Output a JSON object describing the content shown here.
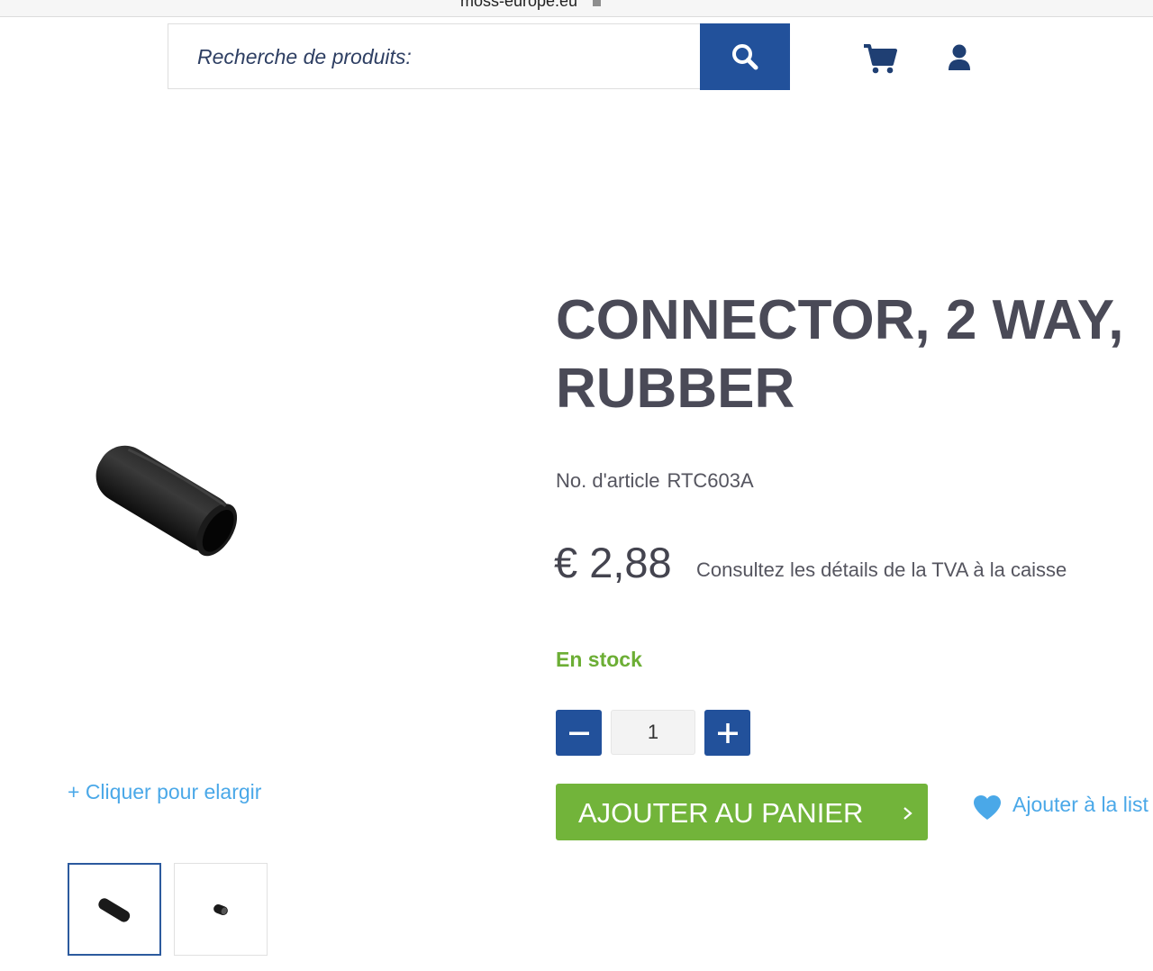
{
  "browser": {
    "url": "moss-europe.eu"
  },
  "header": {
    "search_placeholder": "Recherche de produits:",
    "icons": {
      "search": "search-icon",
      "cart": "cart-icon",
      "account": "user-icon"
    }
  },
  "gallery": {
    "enlarge_label": "+ Cliquer pour elargir",
    "thumbnails": [
      {
        "name": "thumbnail-1",
        "active": true
      },
      {
        "name": "thumbnail-2",
        "active": false
      }
    ]
  },
  "product": {
    "title_line1": "CONNECTOR, 2 WAY,",
    "title_line2": "RUBBER",
    "sku_label": "No. d'article",
    "sku_value": "RTC603A",
    "price": "€ 2,88",
    "vat_note": "Consultez les détails de la TVA à la caisse",
    "stock_status": "En stock",
    "quantity": "1",
    "add_to_cart_label": "AJOUTER AU PANIER",
    "wishlist_label": "Ajouter à la list"
  },
  "colors": {
    "brand_blue": "#22519b",
    "cta_green": "#72b43a",
    "stock_green": "#6cae35",
    "link_blue": "#4aa8e8",
    "text_dark": "#4a4a57"
  }
}
